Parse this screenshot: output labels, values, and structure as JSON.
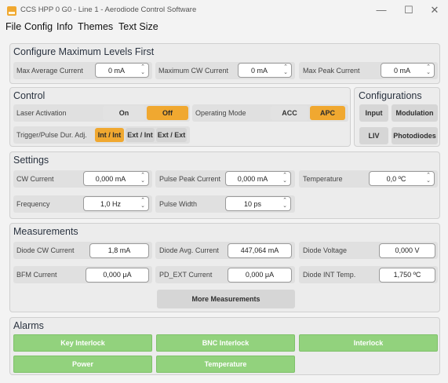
{
  "window": {
    "title": "CCS HPP 0 G0 - Line 1 - Aerodiode Control Software",
    "minimize": "—",
    "maximize": "☐",
    "close": "✕"
  },
  "menu": {
    "file": "File",
    "config": "Config",
    "info": "Info",
    "themes": "Themes",
    "text_size": "Text Size"
  },
  "max_levels": {
    "title": "Configure Maximum Levels First",
    "avg_label": "Max Average Current",
    "avg_value": "0 mA",
    "cw_label": "Maximum CW Current",
    "cw_value": "0 mA",
    "peak_label": "Max Peak Current",
    "peak_value": "0 mA"
  },
  "control": {
    "title": "Control",
    "laser_label": "Laser Activation",
    "laser_on": "On",
    "laser_off": "Off",
    "mode_label": "Operating Mode",
    "mode_acc": "ACC",
    "mode_apc": "APC",
    "trigger_label": "Trigger/Pulse Dur. Adj.",
    "trig_int_int": "Int / Int",
    "trig_ext_int": "Ext / Int",
    "trig_ext_ext": "Ext / Ext"
  },
  "configurations": {
    "title": "Configurations",
    "input": "Input",
    "modulation": "Modulation",
    "liv": "LIV",
    "photodiodes": "Photodiodes"
  },
  "settings": {
    "title": "Settings",
    "cw_label": "CW Current",
    "cw_value": "0,000 mA",
    "peak_label": "Pulse Peak Current",
    "peak_value": "0,000 mA",
    "temp_label": "Temperature",
    "temp_value": "0,0 ºC",
    "freq_label": "Frequency",
    "freq_value": "1,0 Hz",
    "width_label": "Pulse Width",
    "width_value": "10 ps"
  },
  "measurements": {
    "title": "Measurements",
    "diode_cw_label": "Diode CW Current",
    "diode_cw_value": "1,8 mA",
    "diode_avg_label": "Diode Avg. Current",
    "diode_avg_value": "447,064 mA",
    "diode_v_label": "Diode Voltage",
    "diode_v_value": "0,000 V",
    "bfm_label": "BFM Current",
    "bfm_value": "0,000 μA",
    "pdext_label": "PD_EXT Current",
    "pdext_value": "0,000 μA",
    "int_temp_label": "Diode INT Temp.",
    "int_temp_value": "1,750 ºC",
    "more_button": "More Measurements"
  },
  "alarms": {
    "title": "Alarms",
    "key_interlock": "Key Interlock",
    "bnc_interlock": "BNC Interlock",
    "interlock": "Interlock",
    "power": "Power",
    "temperature": "Temperature"
  },
  "colors": {
    "accent": "#f0a830",
    "alarm_ok": "#92d27d"
  }
}
